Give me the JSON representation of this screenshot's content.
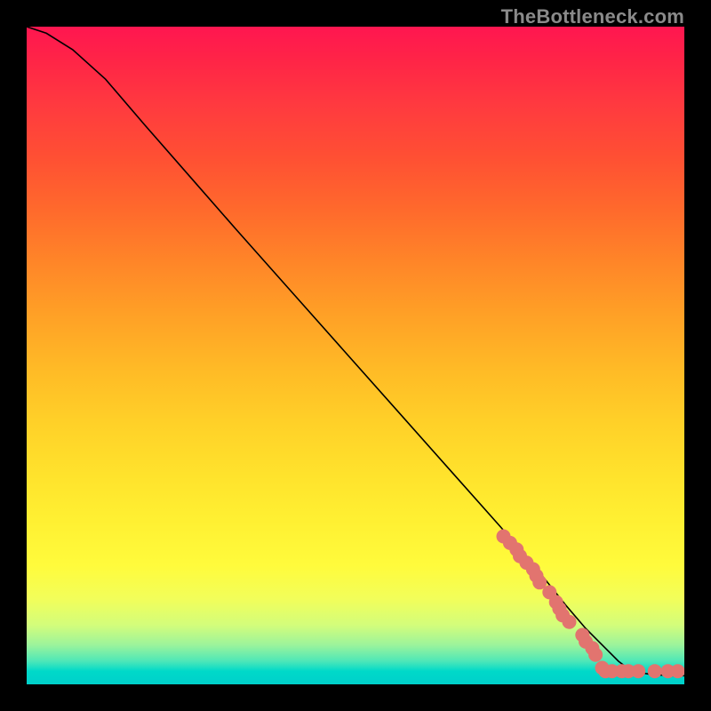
{
  "attribution": "TheBottleneck.com",
  "chart_data": {
    "type": "line",
    "title": "",
    "xlabel": "",
    "ylabel": "",
    "xlim": [
      0,
      100
    ],
    "ylim": [
      0,
      100
    ],
    "scatter_color": "#e2746f",
    "scatter_radius": 8,
    "line_color": "#000000",
    "series": [
      {
        "name": "curve",
        "kind": "line",
        "x": [
          0,
          3,
          7,
          12,
          18,
          25,
          32,
          40,
          48,
          56,
          64,
          72,
          78,
          82,
          85,
          88,
          90,
          92,
          95,
          98,
          100
        ],
        "y": [
          100,
          99,
          96.5,
          92,
          85,
          77,
          69,
          60,
          51,
          42,
          33,
          24,
          17,
          12,
          8.5,
          5.5,
          3.5,
          2,
          1.5,
          1.3,
          1.3
        ]
      },
      {
        "name": "points",
        "kind": "scatter",
        "x": [
          72.5,
          73.5,
          74.5,
          75,
          76,
          77,
          77.5,
          78,
          79.5,
          80.5,
          81,
          81.5,
          82.5,
          84.5,
          85,
          86,
          86.5,
          87.5,
          88,
          89,
          90.5,
          91.5,
          93,
          95.5,
          97.5,
          99
        ],
        "y": [
          22.5,
          21.5,
          20.5,
          19.5,
          18.5,
          17.5,
          16.5,
          15.5,
          14,
          12.5,
          11.5,
          10.5,
          9.5,
          7.5,
          6.5,
          5.5,
          4.5,
          2.5,
          2,
          2,
          2,
          2,
          2,
          2,
          2,
          2
        ]
      }
    ]
  }
}
